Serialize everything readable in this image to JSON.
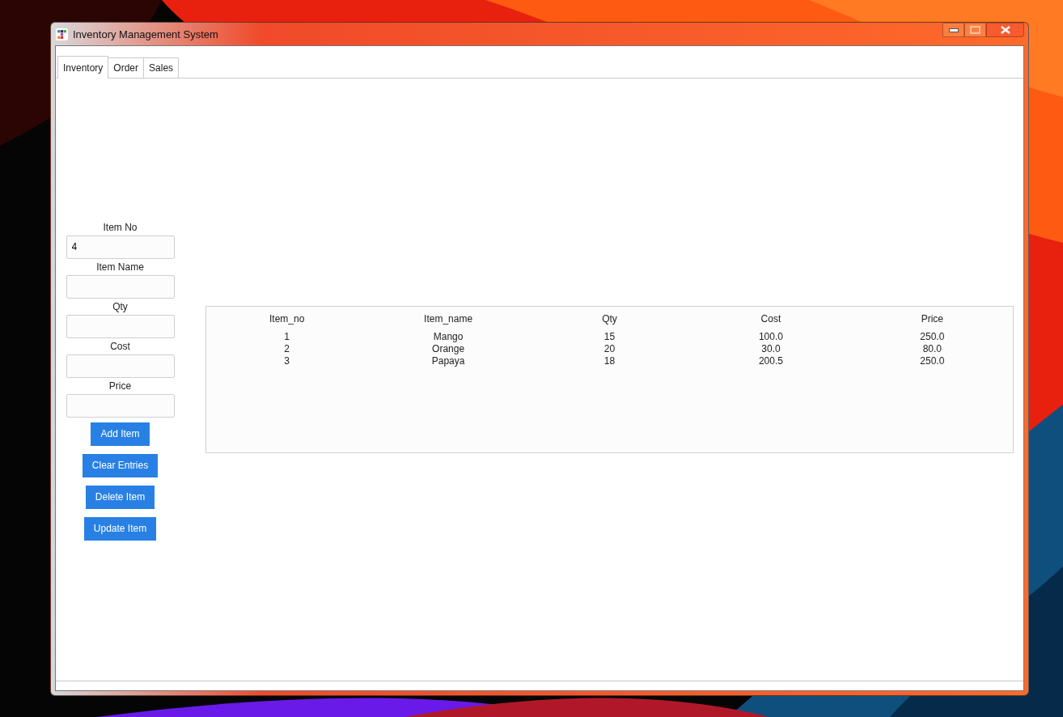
{
  "window": {
    "title": "Inventory Management System"
  },
  "tabs": [
    {
      "label": "Inventory",
      "selected": true
    },
    {
      "label": "Order",
      "selected": false
    },
    {
      "label": "Sales",
      "selected": false
    }
  ],
  "form": {
    "fields": [
      {
        "label": "Item No",
        "value": "4"
      },
      {
        "label": "Item Name"
      },
      {
        "label": "Qty"
      },
      {
        "label": "Cost"
      },
      {
        "label": "Price"
      }
    ],
    "buttons": [
      "Add Item",
      "Clear Entries",
      "Delete Item",
      "Update Item"
    ]
  },
  "table": {
    "columns": [
      "Item_no",
      "Item_name",
      "Qty",
      "Cost",
      "Price"
    ],
    "rows": [
      [
        "1",
        "Mango",
        "15",
        "100.0",
        "250.0"
      ],
      [
        "2",
        "Orange",
        "20",
        "30.0",
        "80.0"
      ],
      [
        "3",
        "Papaya",
        "18",
        "200.5",
        "250.0"
      ]
    ]
  }
}
